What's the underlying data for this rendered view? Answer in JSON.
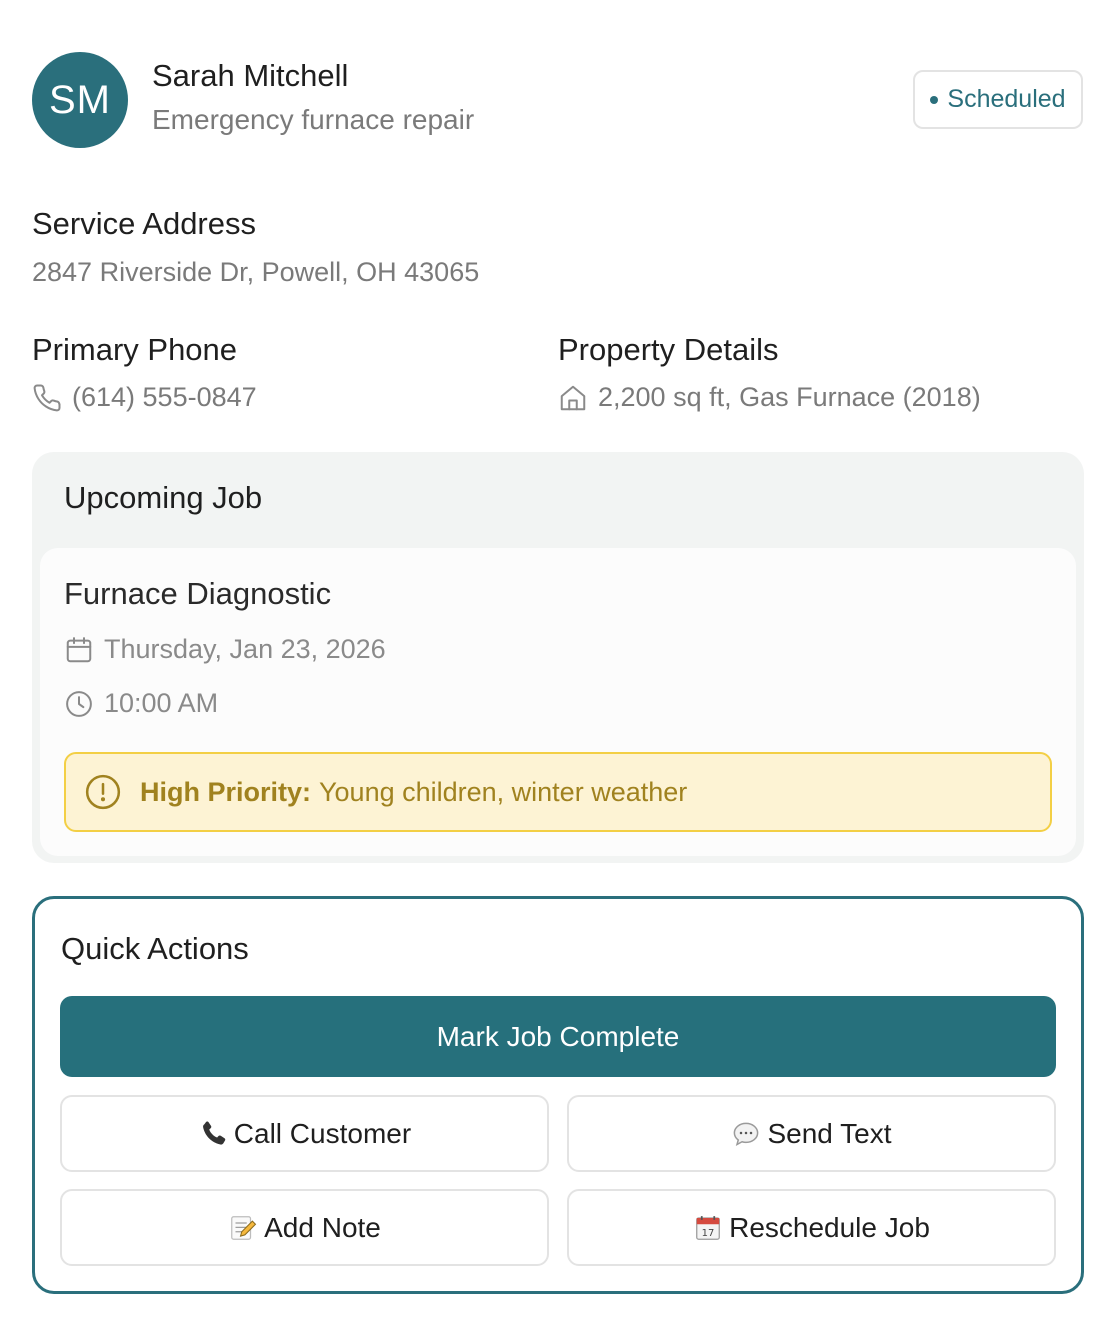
{
  "customer": {
    "initials": "SM",
    "name": "Sarah Mitchell",
    "subtitle": "Emergency furnace repair",
    "status": "Scheduled"
  },
  "service_address": {
    "label": "Service Address",
    "value": "2847 Riverside Dr, Powell, OH 43065"
  },
  "primary_phone": {
    "label": "Primary Phone",
    "value": "(614) 555-0847",
    "icon": "phone-icon"
  },
  "property_details": {
    "label": "Property Details",
    "value": "2,200 sq ft, Gas Furnace (2018)",
    "icon": "home-icon"
  },
  "upcoming_job": {
    "section_title": "Upcoming Job",
    "title": "Furnace Diagnostic",
    "date": "Thursday, Jan 23, 2026",
    "time": "10:00 AM",
    "priority_label": "High Priority:",
    "priority_text": "Young children, winter weather"
  },
  "quick_actions": {
    "title": "Quick Actions",
    "primary": "Mark Job Complete",
    "call": "Call Customer",
    "text": "Send Text",
    "note": "Add Note",
    "reschedule": "Reschedule Job"
  },
  "colors": {
    "accent": "#2a6f7c",
    "priority_bg": "#fdf3d4",
    "priority_border": "#f3cf45",
    "priority_text": "#a0821f"
  }
}
